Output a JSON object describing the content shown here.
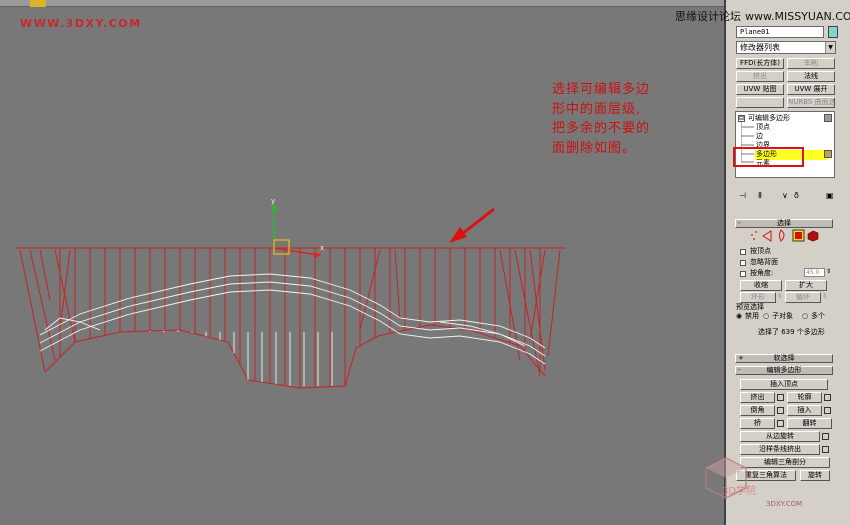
{
  "watermark": "WWW.3DXY.COM",
  "credit": {
    "site": "思缘设计论坛",
    "url": "www.MISSYUAN.COM"
  },
  "annotation": {
    "lines": [
      "选择可编辑多边",
      "形中的面层级,",
      "把多余的不要的",
      "面删除如图。"
    ]
  },
  "viewport": {
    "axis_y": "y",
    "axis_x": "x",
    "colors": {
      "background": "#787878",
      "cage": "#c42424",
      "wire": "#f4f4f4",
      "arrow": "#dd1111",
      "gizmo_y": "#22c022",
      "gizmo_x": "#dd2222",
      "gizmo_box": "#e0b020"
    }
  },
  "panel": {
    "object_name": "Plane01",
    "object_color": "#7fd8c8",
    "modifier_list": "修改器列表",
    "mod_buttons": {
      "ffd": "FFD(长方体)",
      "chamfer": "车削",
      "extrude": "挤出",
      "normal": "法线",
      "uvw_map": "UVW 贴图",
      "uvw_unwrap": "UVW 展开",
      "nurbs": "NURBS 曲面选择"
    },
    "stack": {
      "root": "可编辑多边形",
      "toggle": "⊟",
      "items": [
        "顶点",
        "边",
        "边界",
        "多边形",
        "元素"
      ],
      "selected": "多边形"
    },
    "stack_icons": [
      "pin-icon",
      "show-end-icon",
      "make-unique-icon",
      "remove-modifier-icon",
      "configure-icon"
    ],
    "selection_rollout": {
      "title": "选择",
      "collapse": "-",
      "by_vertex": "按顶点",
      "ignore_backfacing": "忽略背面",
      "by_angle": "按角度:",
      "angle_value": "45.0",
      "shrink": "收缩",
      "grow": "扩大",
      "ring": "环形",
      "loop": "循环",
      "preview_title": "预览选择",
      "preview_options": [
        "禁用",
        "子对象",
        "多个"
      ],
      "preview_selected": "禁用",
      "status": "选择了 639 个多边形"
    },
    "soft_selection": {
      "title": "软选择",
      "expand": "+"
    },
    "edit_polygons": {
      "title": "编辑多边形",
      "collapse": "-",
      "insert_vertex": "插入顶点",
      "extrude": "挤出",
      "outline": "轮廓",
      "bevel": "倒角",
      "inset": "插入",
      "bridge": "桥",
      "flip": "翻转",
      "hinge": "从边旋转",
      "extrude_spline": "沿样条线挤出",
      "edit_tri": "编辑三角剖分",
      "retriangulate": "重复三角算法",
      "turn": "旋转"
    }
  },
  "logo": {
    "mark": "3D学院",
    "url": "3DXY.COM"
  }
}
